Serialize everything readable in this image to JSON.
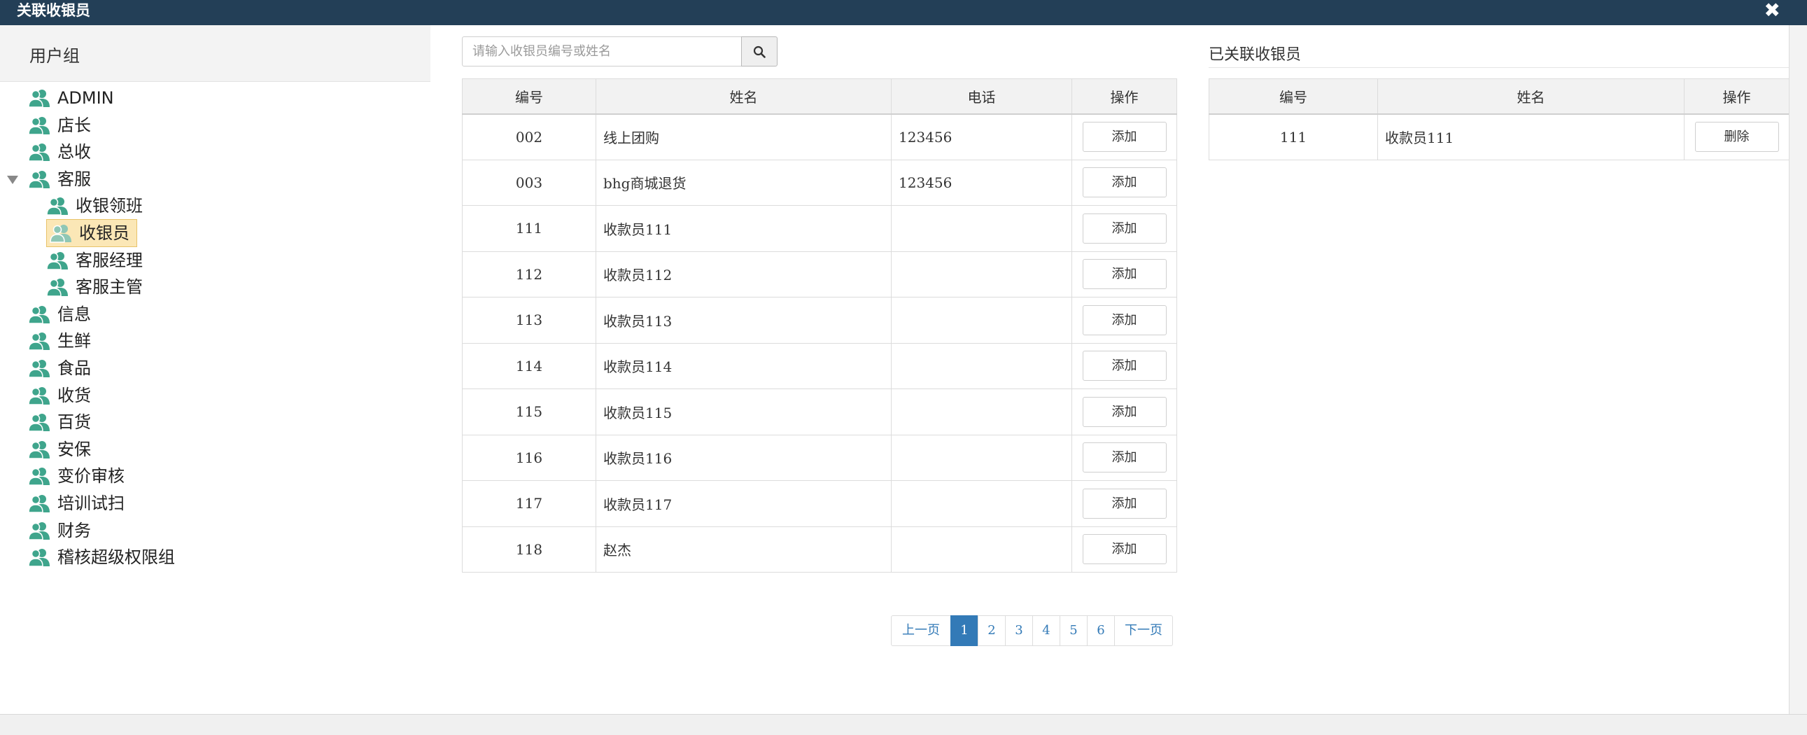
{
  "window": {
    "title": "关联收银员",
    "close_symbol": "✖"
  },
  "left": {
    "header": "用户组",
    "tree": [
      {
        "label": "ADMIN",
        "level": 0
      },
      {
        "label": "店长",
        "level": 0
      },
      {
        "label": "总收",
        "level": 0
      },
      {
        "label": "客服",
        "level": 0,
        "expanded": true
      },
      {
        "label": "收银领班",
        "level": 1
      },
      {
        "label": "收银员",
        "level": 1,
        "selected": true
      },
      {
        "label": "客服经理",
        "level": 1
      },
      {
        "label": "客服主管",
        "level": 1
      },
      {
        "label": "信息",
        "level": 0
      },
      {
        "label": "生鲜",
        "level": 0
      },
      {
        "label": "食品",
        "level": 0
      },
      {
        "label": "收货",
        "level": 0
      },
      {
        "label": "百货",
        "level": 0
      },
      {
        "label": "安保",
        "level": 0
      },
      {
        "label": "变价审核",
        "level": 0
      },
      {
        "label": "培训试扫",
        "level": 0
      },
      {
        "label": "财务",
        "level": 0
      },
      {
        "label": "稽核超级权限组",
        "level": 0
      }
    ],
    "icon": "user-group-icon",
    "icon_color": "#3fa58c"
  },
  "search": {
    "placeholder": "请输入收银员编号或姓名",
    "icon": "search-icon"
  },
  "main_table": {
    "headers": [
      "编号",
      "姓名",
      "电话",
      "操作"
    ],
    "rows": [
      {
        "id": "002",
        "name": "线上团购",
        "phone": "123456",
        "action": "添加"
      },
      {
        "id": "003",
        "name": "bhg商城退货",
        "phone": "123456",
        "action": "添加"
      },
      {
        "id": "111",
        "name": "收款员111",
        "phone": "",
        "action": "添加"
      },
      {
        "id": "112",
        "name": "收款员112",
        "phone": "",
        "action": "添加"
      },
      {
        "id": "113",
        "name": "收款员113",
        "phone": "",
        "action": "添加"
      },
      {
        "id": "114",
        "name": "收款员114",
        "phone": "",
        "action": "添加"
      },
      {
        "id": "115",
        "name": "收款员115",
        "phone": "",
        "action": "添加"
      },
      {
        "id": "116",
        "name": "收款员116",
        "phone": "",
        "action": "添加"
      },
      {
        "id": "117",
        "name": "收款员117",
        "phone": "",
        "action": "添加"
      },
      {
        "id": "118",
        "name": "赵杰",
        "phone": "",
        "action": "添加"
      }
    ]
  },
  "pagination": {
    "prev": "上一页",
    "pages": [
      "1",
      "2",
      "3",
      "4",
      "5",
      "6"
    ],
    "current": "1",
    "next": "下一页",
    "active_color": "#337ab7"
  },
  "right": {
    "title": "已关联收银员",
    "headers": [
      "编号",
      "姓名",
      "操作"
    ],
    "rows": [
      {
        "id": "111",
        "name": "收款员111",
        "action": "删除"
      }
    ]
  },
  "colors": {
    "titlebar": "#233f57"
  }
}
